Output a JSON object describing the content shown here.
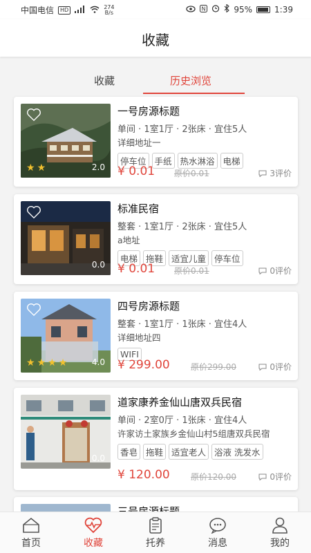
{
  "status_bar": {
    "carrier": "中国电信",
    "hd": "HD",
    "speed_value": "274",
    "speed_unit": "B/s",
    "battery": "95%",
    "time": "1:39"
  },
  "header": {
    "title": "收藏"
  },
  "tabs": [
    {
      "label": "收藏"
    },
    {
      "label": "历史浏览"
    }
  ],
  "active_tab": "历史浏览",
  "listings": [
    {
      "name": "一号房源标题",
      "meta": "单间 · 1室1厅 · 2张床 · 宜住5人",
      "address": "详细地址一",
      "tags": [
        "停车位",
        "手纸",
        "热水淋浴",
        "电梯"
      ],
      "price": "¥ 0.01",
      "original_price": "原价0.01",
      "reviews": "3评价",
      "score": "2.0",
      "stars": 2
    },
    {
      "name": "标准民宿",
      "meta": "整套 · 1室1厅 · 2张床 · 宜住5人",
      "address": "a地址",
      "tags": [
        "电梯",
        "拖鞋",
        "适宜儿童",
        "停车位"
      ],
      "price": "¥ 0.01",
      "original_price": "原价0.01",
      "reviews": "0评价",
      "score": "0.0",
      "stars": 0
    },
    {
      "name": "四号房源标题",
      "meta": "整套 · 1室1厅 · 1张床 · 宜住4人",
      "address": "详细地址四",
      "tags": [
        "WIFI"
      ],
      "price": "¥ 299.00",
      "original_price": "原价299.00",
      "reviews": "0评价",
      "score": "4.0",
      "stars": 4
    },
    {
      "name": "道家康养金仙山唐双兵民宿",
      "meta": "单间 · 2室0厅 · 1张床 · 宜住4人",
      "address": "许家访土家族乡金仙山村5组唐双兵民宿",
      "tags": [
        "香皂",
        "拖鞋",
        "适宜老人",
        "浴液 洗发水"
      ],
      "price": "¥ 120.00",
      "original_price": "原价120.00",
      "reviews": "0评价",
      "score": "0.0",
      "stars": 0
    },
    {
      "name": "三号房源标题"
    }
  ],
  "bottom_nav": [
    {
      "label": "首页",
      "icon": "home-icon"
    },
    {
      "label": "收藏",
      "icon": "heart-pulse-icon",
      "active": true
    },
    {
      "label": "托养",
      "icon": "clipboard-icon"
    },
    {
      "label": "消息",
      "icon": "chat-bubble-icon"
    },
    {
      "label": "我的",
      "icon": "user-icon"
    }
  ],
  "colors": {
    "accent": "#e0443a",
    "star": "#f2c12e"
  }
}
